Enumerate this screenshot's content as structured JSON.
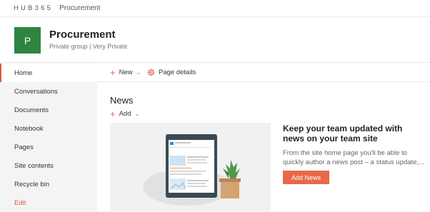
{
  "suite_bar": {
    "brand": "HUB365",
    "site_link": "Procurement"
  },
  "site": {
    "logo_letter": "P",
    "logo_color": "#2e8540",
    "title": "Procurement",
    "subtitle": "Private group | Very Private"
  },
  "left_nav": {
    "items": [
      {
        "label": "Home",
        "active": true
      },
      {
        "label": "Conversations"
      },
      {
        "label": "Documents"
      },
      {
        "label": "Notebook"
      },
      {
        "label": "Pages"
      },
      {
        "label": "Site contents"
      },
      {
        "label": "Recycle bin"
      },
      {
        "label": "Edit"
      }
    ]
  },
  "command_bar": {
    "new_label": "New",
    "page_details_label": "Page details"
  },
  "news": {
    "title": "News",
    "add_label": "Add",
    "promo_title": "Keep your team updated with news on your team site",
    "promo_text": "From the site home page you'll be able to quickly author a news post – a status update,...",
    "add_news_button": "Add News"
  },
  "colors": {
    "accent": "#e8694a",
    "nav_bg": "#f4f4f4"
  }
}
